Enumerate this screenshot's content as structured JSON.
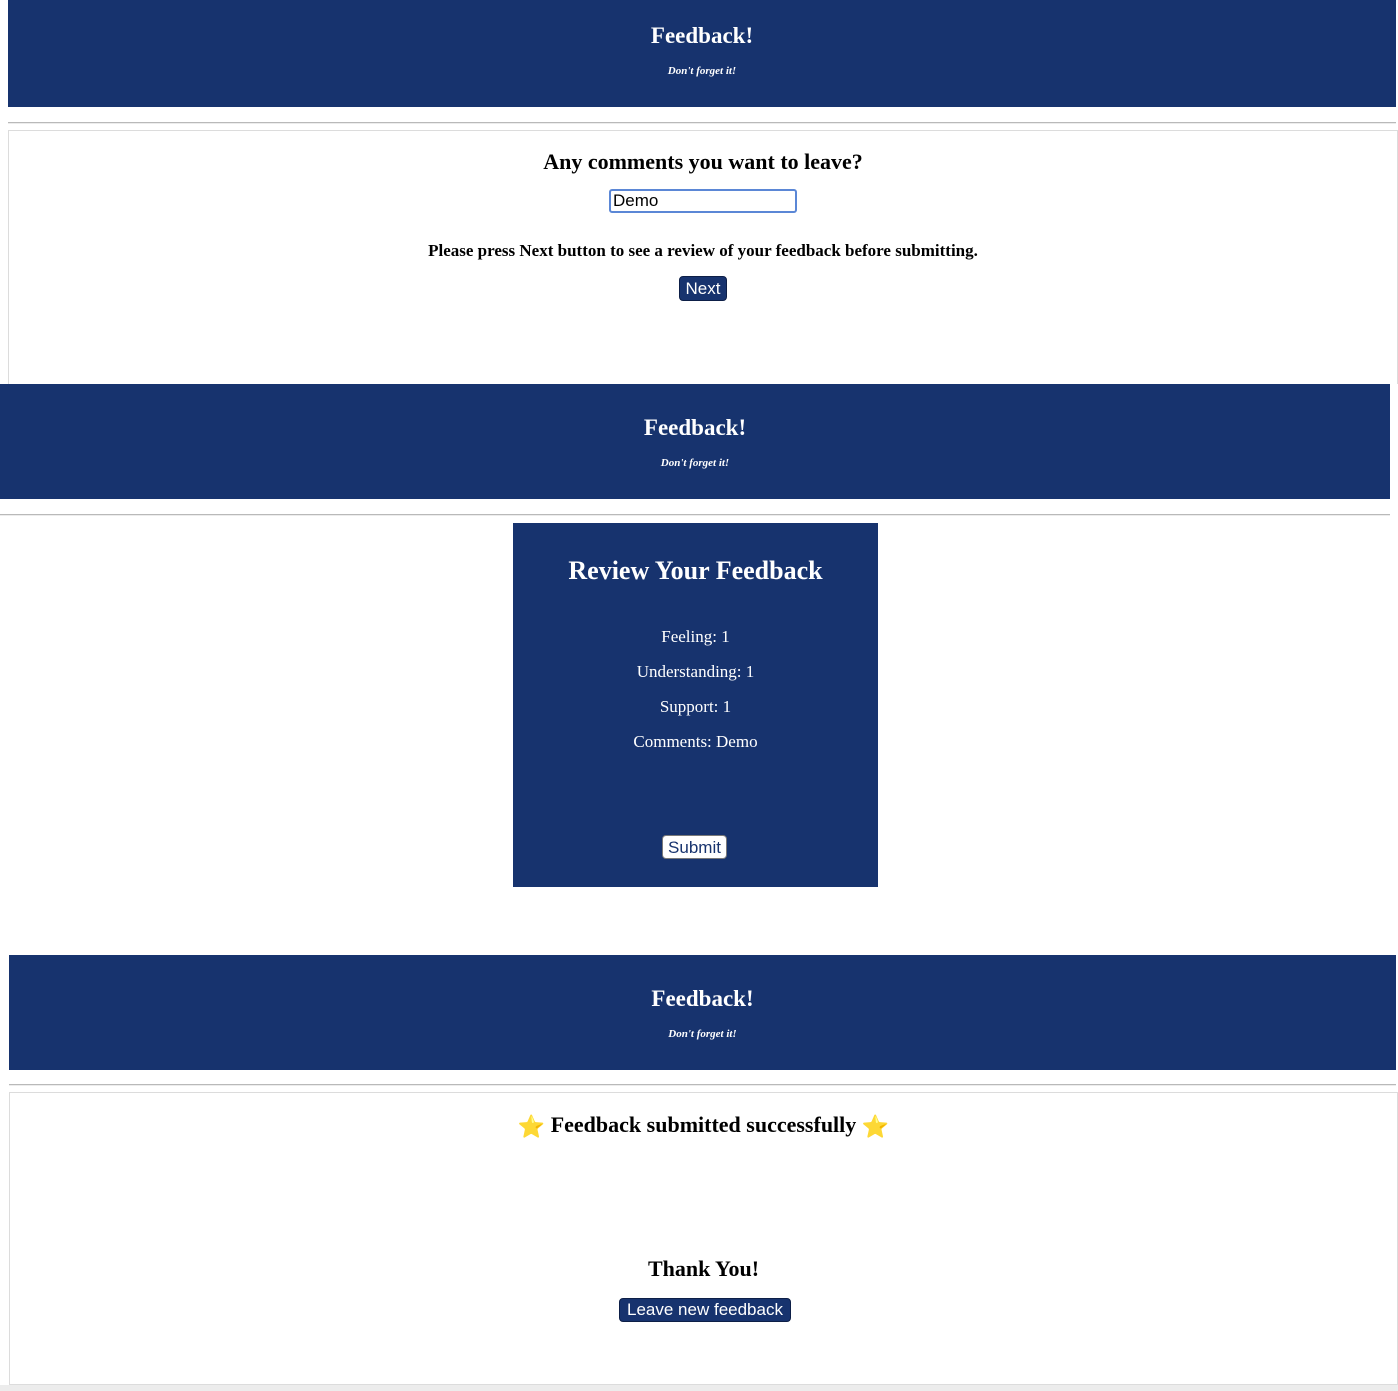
{
  "header": {
    "title": "Feedback!",
    "subtitle": "Don't forget it!"
  },
  "comments_step": {
    "question": "Any comments you want to leave?",
    "input_value": "Demo",
    "instruction": "Please press Next button to see a review of your feedback before submitting.",
    "next_label": "Next"
  },
  "review_step": {
    "heading": "Review Your Feedback",
    "feeling": "Feeling: 1",
    "understanding": "Understanding: 1",
    "support": "Support: 1",
    "comments": "Comments: Demo",
    "submit_label": "Submit"
  },
  "success_step": {
    "message": "Feedback submitted successfully",
    "star_icon": "⭐",
    "thank_you": "Thank You!",
    "leave_new_label": "Leave new feedback"
  },
  "colors": {
    "brand": "#17336e",
    "star": "#f6c544"
  }
}
